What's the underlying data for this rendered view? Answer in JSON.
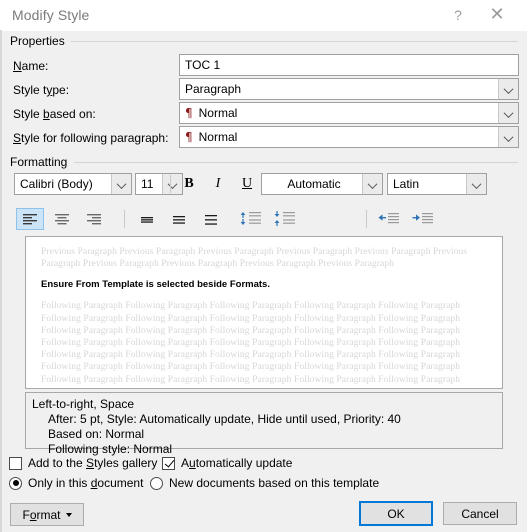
{
  "window": {
    "title": "Modify Style",
    "help_icon": "question-mark-icon",
    "close_icon": "close-icon"
  },
  "properties": {
    "group_label": "Properties",
    "name_label": "Name:",
    "name_value": "TOC 1",
    "style_type_label": "Style type:",
    "style_type_value": "Paragraph",
    "style_based_on_label": "Style based on:",
    "style_based_on_value": "Normal",
    "style_following_label": "Style for following paragraph:",
    "style_following_value": "Normal",
    "pilcrow": "¶"
  },
  "formatting": {
    "group_label": "Formatting",
    "font_family": "Calibri (Body)",
    "font_size": "11",
    "bold": "B",
    "italic": "I",
    "underline": "U",
    "font_color": "Automatic",
    "script": "Latin"
  },
  "preview": {
    "previous_paragraph": "Previous Paragraph Previous Paragraph Previous Paragraph Previous Paragraph Previous Paragraph Previous Paragraph Previous Paragraph Previous Paragraph Previous Paragraph Previous Paragraph",
    "sample_text": "Ensure From Template is selected beside Formats.",
    "following_paragraph_line": "Following Paragraph Following Paragraph Following Paragraph Following Paragraph Following Paragraph",
    "following_line_count": 7
  },
  "description": {
    "line1": "Left-to-right, Space",
    "line2": "After:  5 pt, Style: Automatically update, Hide until used, Priority: 40",
    "line3": "Based on: Normal",
    "line4": "Following style: Normal"
  },
  "options": {
    "add_to_gallery_label": "Add to the Styles gallery",
    "add_to_gallery_checked": false,
    "auto_update_label": "Automatically update",
    "auto_update_checked": true,
    "only_this_document_label": "Only in this document",
    "only_this_document_selected": true,
    "new_documents_label": "New documents based on this template",
    "new_documents_selected": false
  },
  "footer": {
    "format_label": "Format",
    "ok_label": "OK",
    "cancel_label": "Cancel"
  },
  "colors": {
    "dialog_bg": "#f0f0f0",
    "focus_blue": "#0078d7",
    "selected_toolbar": "#cce4f7",
    "pilcrow_red": "#8a1a1a"
  }
}
